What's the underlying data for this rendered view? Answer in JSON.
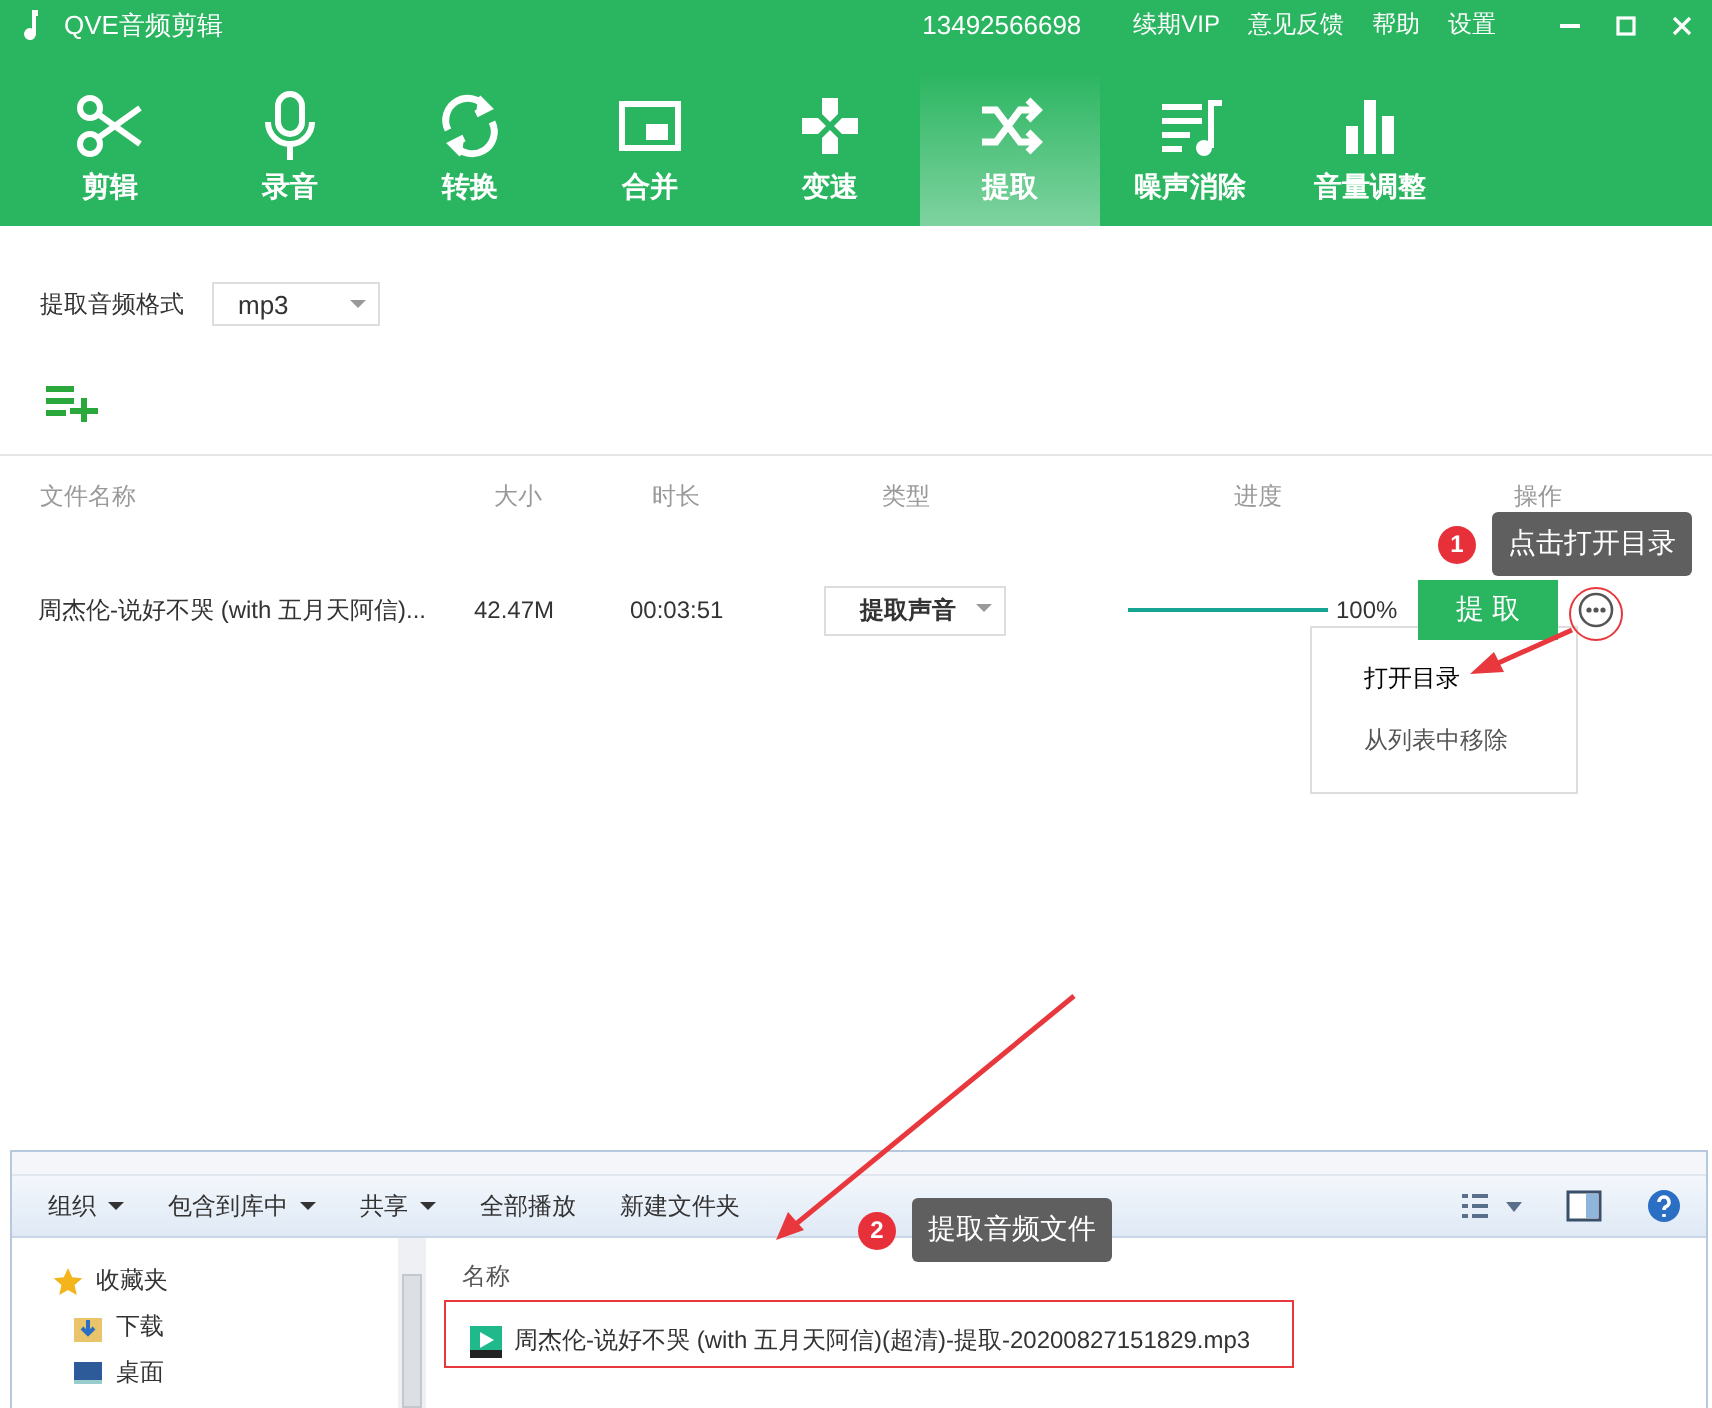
{
  "app": {
    "title": "QVE音频剪辑",
    "phone": "13492566698",
    "links": [
      "续期VIP",
      "意见反馈",
      "帮助",
      "设置"
    ]
  },
  "tabs": [
    {
      "label": "剪辑",
      "kind": "scissors",
      "selected": false
    },
    {
      "label": "录音",
      "kind": "mic",
      "selected": false
    },
    {
      "label": "转换",
      "kind": "convert",
      "selected": false
    },
    {
      "label": "合并",
      "kind": "merge",
      "selected": false
    },
    {
      "label": "变速",
      "kind": "speed",
      "selected": false
    },
    {
      "label": "提取",
      "kind": "shuffle",
      "selected": true
    },
    {
      "label": "噪声消除",
      "kind": "denoise",
      "selected": false
    },
    {
      "label": "音量调整",
      "kind": "volume",
      "selected": false
    }
  ],
  "format": {
    "label": "提取音频格式",
    "value": "mp3"
  },
  "table": {
    "columns": [
      "文件名称",
      "大小",
      "时长",
      "类型",
      "进度",
      "操作"
    ],
    "rows": [
      {
        "name": "周杰伦-说好不哭 (with 五月天阿信)...",
        "size": "42.47M",
        "duration": "00:03:51",
        "type": "提取声音",
        "level": 1,
        "reading": "100%",
        "action": "提 取"
      }
    ]
  },
  "menu": {
    "items": [
      "打开目录",
      "从列表中移除"
    ]
  },
  "explorer": {
    "toolbar": [
      "组织",
      "包含到库中",
      "共享",
      "全部播放",
      "新建文件夹"
    ],
    "nav": [
      {
        "label": "收藏夹",
        "kind": "star"
      },
      {
        "label": "下载",
        "kind": "download"
      },
      {
        "label": "桌面",
        "kind": "desktop"
      }
    ],
    "column": "名称",
    "file": "周杰伦-说好不哭 (with 五月天阿信)(超清)-提取-20200827151829.mp3"
  },
  "callouts": [
    {
      "number": "1",
      "text": "点击打开目录"
    },
    {
      "number": "2",
      "text": "提取音频文件"
    }
  ]
}
